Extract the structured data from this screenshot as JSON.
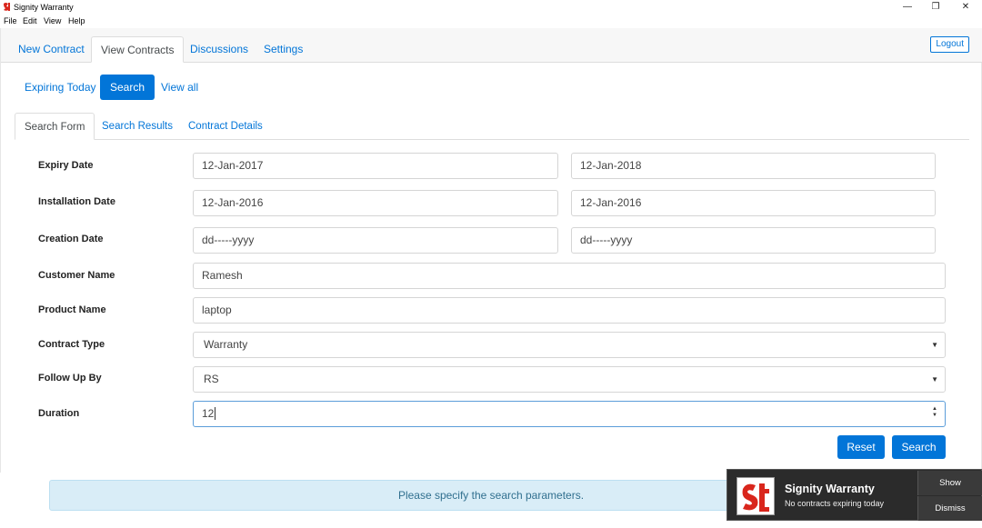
{
  "window": {
    "title": "Signity Warranty",
    "minimize": "—",
    "restore": "❐",
    "close": "✕"
  },
  "menu": [
    "File",
    "Edit",
    "View",
    "Help"
  ],
  "nav": {
    "tabs": [
      "New Contract",
      "View Contracts",
      "Discussions",
      "Settings"
    ],
    "active_tab": "View Contracts",
    "logout": "Logout"
  },
  "pills": [
    "Expiring Today",
    "Search",
    "View all"
  ],
  "subtabs": [
    "Search Form",
    "Search Results",
    "Contract Details"
  ],
  "form": {
    "expiry_date": {
      "label": "Expiry Date",
      "from": "12-Jan-2017",
      "to": "12-Jan-2018"
    },
    "installation_date": {
      "label": "Installation Date",
      "from": "12-Jan-2016",
      "to": "12-Jan-2016"
    },
    "creation_date": {
      "label": "Creation Date",
      "from": "dd-----yyyy",
      "to": "dd-----yyyy"
    },
    "customer_name": {
      "label": "Customer Name",
      "value": "Ramesh"
    },
    "product_name": {
      "label": "Product Name",
      "value": "laptop"
    },
    "contract_type": {
      "label": "Contract Type",
      "value": "Warranty"
    },
    "follow_up_by": {
      "label": "Follow Up By",
      "value": "RS"
    },
    "duration": {
      "label": "Duration",
      "value": "12"
    },
    "reset": "Reset",
    "search": "Search"
  },
  "alert": "Please specify the search parameters.",
  "toast": {
    "title": "Signity Warranty",
    "message": "No contracts expiring today",
    "show": "Show",
    "dismiss": "Dismiss"
  },
  "colors": {
    "accent": "#0275d8",
    "alert_bg": "#d9edf7",
    "brand_red": "#d9261c"
  }
}
